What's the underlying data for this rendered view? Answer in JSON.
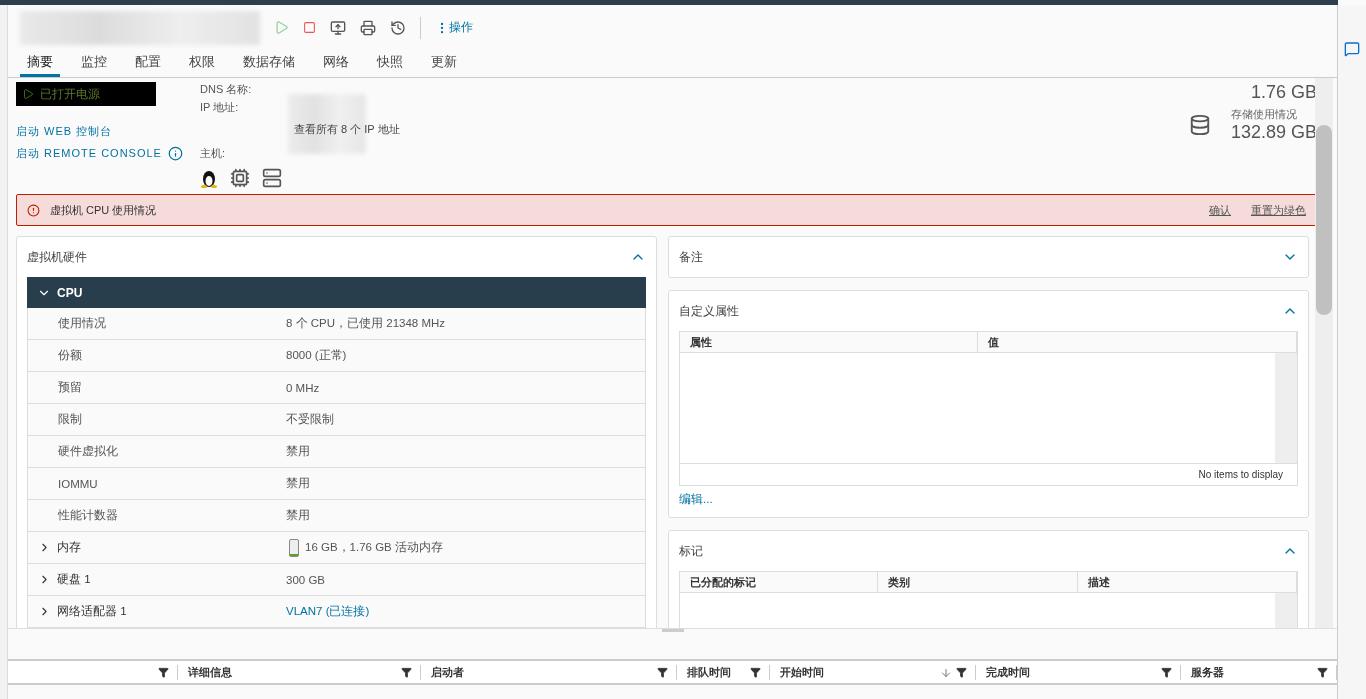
{
  "toolbar": {
    "actions_label": "操作"
  },
  "tabs": [
    {
      "label": "摘要",
      "selected": true
    },
    {
      "label": "监控",
      "selected": false
    },
    {
      "label": "配置",
      "selected": false
    },
    {
      "label": "权限",
      "selected": false
    },
    {
      "label": "数据存储",
      "selected": false
    },
    {
      "label": "网络",
      "selected": false
    },
    {
      "label": "快照",
      "selected": false
    },
    {
      "label": "更新",
      "selected": false
    }
  ],
  "summary": {
    "power_state": "已打开电源",
    "console_links": [
      "启动 WEB 控制台",
      "启动 REMOTE CONSOLE"
    ],
    "dns_label": "DNS 名称:",
    "ip_label": "IP 地址:",
    "ip_link": "查看所有 8 个 IP 地址",
    "host_label": "主机:",
    "memory_value": "1.76 GB",
    "storage_label": "存储使用情况",
    "storage_value": "132.89 GB"
  },
  "alert": {
    "message": "虚拟机 CPU 使用情况",
    "actions": [
      "确认",
      "重置为绿色"
    ]
  },
  "hardware": {
    "title": "虚拟机硬件",
    "expanded": true,
    "groups": [
      {
        "name": "CPU",
        "expanded": true,
        "rows": [
          {
            "label": "使用情况",
            "value": "8 个 CPU，已使用 21348 MHz"
          },
          {
            "label": "份额",
            "value": "8000 (正常)"
          },
          {
            "label": "预留",
            "value": "0 MHz"
          },
          {
            "label": "限制",
            "value": "不受限制"
          },
          {
            "label": "硬件虚拟化",
            "value": "禁用"
          },
          {
            "label": "IOMMU",
            "value": "禁用"
          },
          {
            "label": "性能计数器",
            "value": "禁用"
          }
        ]
      },
      {
        "name": "内存",
        "expanded": false,
        "kind": "memory",
        "value": "16 GB，1.76 GB 活动内存",
        "level": 0.12
      },
      {
        "name": "硬盘 1",
        "expanded": false,
        "kind": "plain",
        "value": "300 GB"
      },
      {
        "name": "网络适配器 1",
        "expanded": false,
        "kind": "link",
        "value": "VLAN7 (已连接)"
      }
    ]
  },
  "notes": {
    "title": "备注",
    "expanded": false
  },
  "custom_attributes": {
    "title": "自定义属性",
    "expanded": true,
    "columns": [
      "属性",
      "值"
    ],
    "empty_text": "No items to display",
    "edit_link": "编辑..."
  },
  "tags": {
    "title": "标记",
    "expanded": true,
    "columns": [
      "已分配的标记",
      "类别",
      "描述"
    ]
  },
  "tasks": {
    "columns": [
      {
        "sorted": false
      },
      {
        "label": "详细信息",
        "sorted": false
      },
      {
        "label": "启动者",
        "sorted": false
      },
      {
        "label": "排队时间",
        "sorted": false
      },
      {
        "label": "开始时间",
        "sorted": true
      },
      {
        "label": "完成时间",
        "sorted": false
      },
      {
        "label": "服务器",
        "sorted": false
      }
    ]
  }
}
